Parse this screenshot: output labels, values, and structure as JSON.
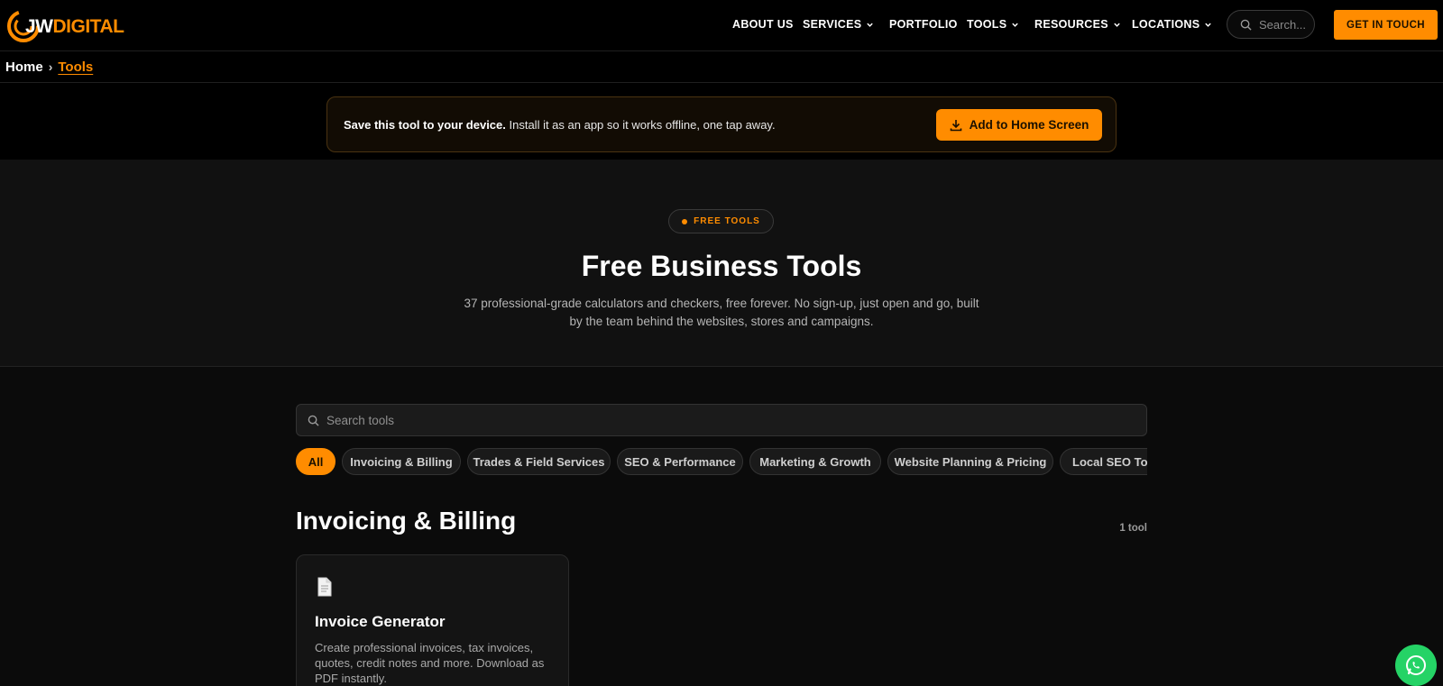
{
  "brand": {
    "logo_text_a": "JW",
    "logo_text_b": "DIGITAL",
    "accent": "#ff8c00"
  },
  "nav": {
    "items": [
      {
        "label": "ABOUT US",
        "has_dropdown": false
      },
      {
        "label": "SERVICES",
        "has_dropdown": true
      },
      {
        "label": "PORTFOLIO",
        "has_dropdown": false
      },
      {
        "label": "TOOLS",
        "has_dropdown": true
      },
      {
        "label": "RESOURCES",
        "has_dropdown": true
      },
      {
        "label": "LOCATIONS",
        "has_dropdown": true
      }
    ],
    "search_placeholder": "Search...",
    "cta_label": "GET IN TOUCH"
  },
  "breadcrumb": {
    "home": "Home",
    "separator": "›",
    "current": "Tools"
  },
  "install_banner": {
    "bold": "Save this tool to your device.",
    "text": " Install it as an app so it works offline, one tap away.",
    "button_label": "Add to Home Screen"
  },
  "hero": {
    "badge": "FREE TOOLS",
    "title": "Free Business Tools",
    "subtitle": "37 professional-grade calculators and checkers, free forever. No sign-up, just open and go, built by the team behind the websites, stores and campaigns."
  },
  "tools": {
    "search_placeholder": "Search tools",
    "filters": [
      {
        "label": "All",
        "active": true
      },
      {
        "label": "Invoicing & Billing",
        "active": false
      },
      {
        "label": "Trades & Field Services",
        "active": false
      },
      {
        "label": "SEO & Performance",
        "active": false
      },
      {
        "label": "Marketing & Growth",
        "active": false
      },
      {
        "label": "Website Planning & Pricing",
        "active": false
      },
      {
        "label": "Local SEO Tools",
        "active": false
      }
    ],
    "sections": [
      {
        "title": "Invoicing & Billing",
        "count": "1 tool",
        "cards": [
          {
            "icon": "document-icon",
            "title": "Invoice Generator",
            "description": "Create professional invoices, tax invoices, quotes, credit notes and more. Download as PDF instantly."
          }
        ]
      }
    ]
  },
  "whatsapp": {
    "icon": "whatsapp-icon",
    "color": "#25d366"
  }
}
